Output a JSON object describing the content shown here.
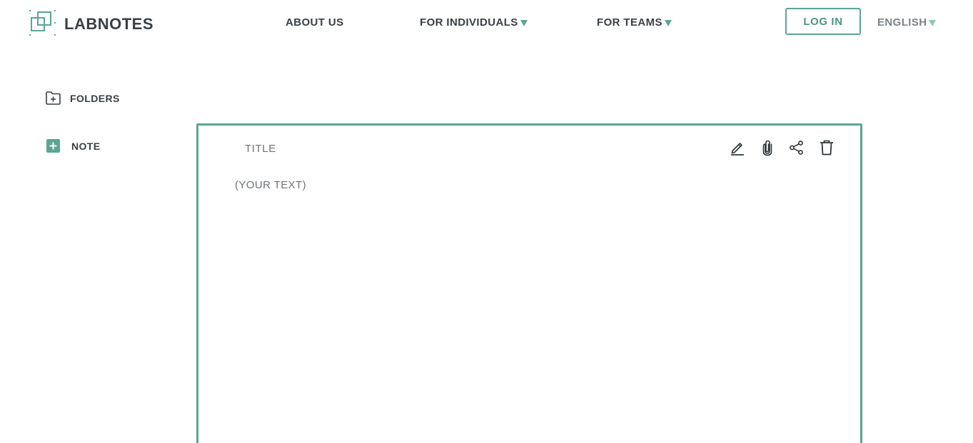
{
  "brand": {
    "name": "LABNOTES",
    "accent_color": "#5ba595",
    "text_color": "#3a3f44"
  },
  "nav": {
    "about": "ABOUT US",
    "individuals": "FOR INDIVIDUALS",
    "teams": "FOR TEAMS",
    "login": "LOG IN",
    "language": "ENGLISH"
  },
  "sidebar": {
    "folders_label": "FOLDERS",
    "folders_icon": "folder-plus-icon",
    "note_label": "NOTE",
    "note_icon": "plus-square-icon"
  },
  "editor": {
    "title_placeholder": "TITLE",
    "body_placeholder": "(YOUR TEXT)",
    "tools": [
      "pencil-icon",
      "paperclip-icon",
      "share-icon",
      "trash-icon"
    ]
  }
}
